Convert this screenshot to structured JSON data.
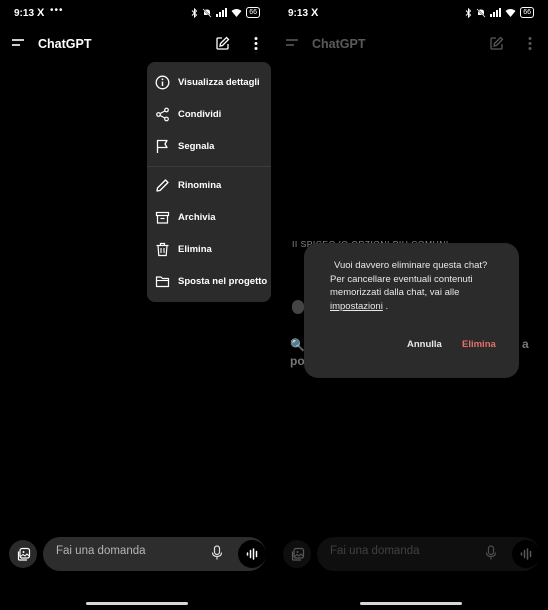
{
  "status": {
    "time": "9:13",
    "x_label": "X",
    "dots": "•••",
    "battery": "66"
  },
  "app": {
    "title": "ChatGPT"
  },
  "menu": {
    "items": [
      {
        "label": "Visualizza dettagli",
        "icon": "info-icon"
      },
      {
        "label": "Condividi",
        "icon": "share-icon"
      },
      {
        "label": "Segnala",
        "icon": "flag-icon"
      },
      {
        "label": "Rinomina",
        "icon": "pencil-icon"
      },
      {
        "label": "Archivia",
        "icon": "archive-icon"
      },
      {
        "label": "Elimina",
        "icon": "trash-icon"
      },
      {
        "label": "Sposta nel progetto",
        "icon": "folder-icon"
      }
    ]
  },
  "composer": {
    "placeholder": "Fai una domanda"
  },
  "dialog": {
    "line1": "Vuoi davvero eliminare questa chat?",
    "line2": "Per cancellare eventuali contenuti memorizzati dalla chat, vai alle",
    "link": "impostazioni",
    "tail": " .",
    "cancel": "Annulla",
    "confirm": "Elimina"
  },
  "background": {
    "partial_text": "II SPICEO IO OPZIONI PIU COMUNI",
    "q_left": "po",
    "q_right": "a"
  },
  "colors": {
    "background": "#000000",
    "menu_bg": "#2b2b2b",
    "input_bg": "#2d2d2d",
    "danger": "#e4706a"
  }
}
